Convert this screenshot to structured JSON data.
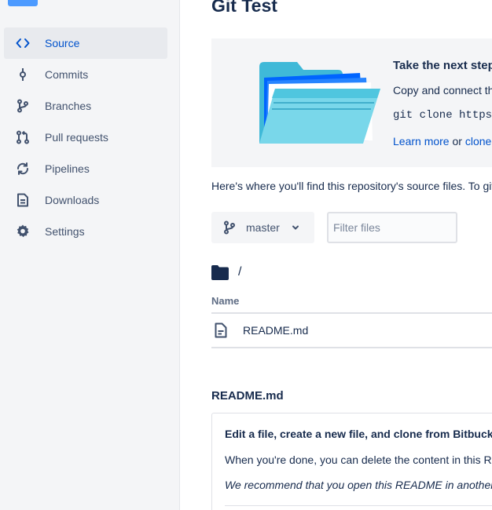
{
  "sidebar": {
    "items": [
      {
        "label": "Source",
        "icon": "code-icon"
      },
      {
        "label": "Commits",
        "icon": "commit-icon"
      },
      {
        "label": "Branches",
        "icon": "branch-icon"
      },
      {
        "label": "Pull requests",
        "icon": "pull-request-icon"
      },
      {
        "label": "Pipelines",
        "icon": "pipelines-icon"
      },
      {
        "label": "Downloads",
        "icon": "download-file-icon"
      },
      {
        "label": "Settings",
        "icon": "gear-icon"
      }
    ],
    "active_index": 0
  },
  "main": {
    "title": "Git Test",
    "banner": {
      "heading": "Take the next step",
      "text": "Copy and connect th",
      "code": "git clone https:/",
      "link_learn": "Learn more",
      "link_or": " or ",
      "link_clone": "clone"
    },
    "hint": "Here's where you'll find this repository's source files. To giv",
    "branch": {
      "label": "master",
      "icon": "branch-icon"
    },
    "filter": {
      "placeholder": "Filter files",
      "value": ""
    },
    "path": "/",
    "table": {
      "column_header": "Name",
      "rows": [
        {
          "name": "README.md",
          "icon": "file-icon"
        }
      ]
    },
    "readme": {
      "title": "README.md",
      "heading": "Edit a file, create a new file, and clone from Bitbuck",
      "paragraph": "When you're done, you can delete the content in this R",
      "italic": "We recommend that you open this README in another t"
    }
  },
  "colors": {
    "accent": "#0052cc",
    "sidebar_bg": "#f4f5f7",
    "text": "#172b4d",
    "muted": "#42526e"
  }
}
